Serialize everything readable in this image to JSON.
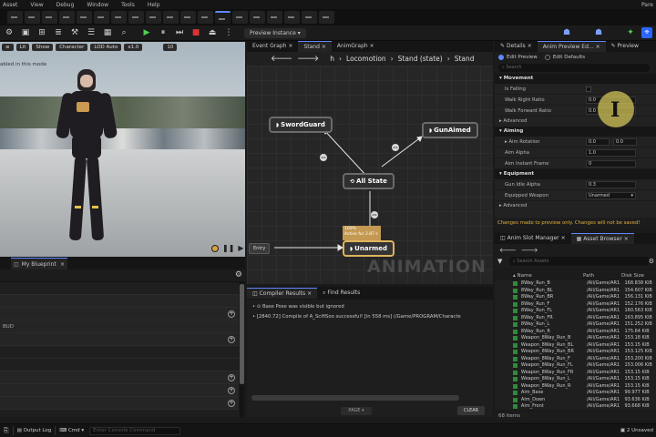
{
  "menubar": [
    "Asset",
    "View",
    "Debug",
    "Window",
    "Tools",
    "Help"
  ],
  "toolbar": {
    "preview_instance": "Preview Instance",
    "top_right_label": "Pare"
  },
  "viewport": {
    "buttons": [
      "Lit",
      "Show",
      "Character",
      "LOD Auto",
      "x1.0"
    ],
    "camera_speed": "10",
    "notice": "abled in this mode"
  },
  "blueprint_panel": {
    "tab_label": "My Blueprint",
    "row_label_a": "BUD"
  },
  "graph": {
    "tabs": [
      "Event Graph",
      "Stand",
      "AnimGraph"
    ],
    "breadcrumb": [
      "h",
      "Locomotion",
      "Stand (state)",
      "Stand"
    ],
    "nodes": {
      "sword_guard": "SwordGuard",
      "gun_aimed": "GunAimed",
      "all_state": "All State",
      "unarmed": "Unarmed"
    },
    "unarmed_tip_line1": "100%",
    "unarmed_tip_line2": "Active for 2.87 s",
    "entry": "Entry",
    "watermark": "ANIMATION"
  },
  "compiler": {
    "tabs": [
      "Compiler Results",
      "Find Results"
    ],
    "lines": [
      "Base Pose  was visible but ignored",
      "[2840.72] Compile of A_ScifiSoo successful! [in 558 ms] (/Game/PROGRAM/Characte"
    ],
    "page_label": "PAGE",
    "clear_label": "CLEAR"
  },
  "details": {
    "tabs": [
      "Details",
      "Anim Preview Ed...",
      "Preview"
    ],
    "edit_preview": "Edit Preview",
    "edit_defaults": "Edit Defaults",
    "search_placeholder": "Search",
    "movement_section": "Movement",
    "movement_props": [
      {
        "label": "Is Falling",
        "value": ""
      },
      {
        "label": "Walk Right Ratio",
        "value": "0.0"
      },
      {
        "label": "Walk Forward Ratio",
        "value": "0.0"
      }
    ],
    "advanced_label": "Advanced",
    "aiming_section": "Aiming",
    "aim_rotation": "Aim Rotation",
    "aim_rotation_values": [
      "0.0",
      "0.0"
    ],
    "aim_alpha": "Aim Alpha",
    "aim_alpha_value": "1.0",
    "aim_instant_frame": "Aim Instant Frame",
    "aim_instant_frame_value": "0",
    "equipment_section": "Equipment",
    "gun_idle_alpha": "Gun Idle Alpha",
    "gun_idle_alpha_value": "0.3",
    "equipped_weapon": "Equipped Weapon",
    "equipped_weapon_value": "Unarmed",
    "warning": "Changes made to preview only. Changes will not be saved!"
  },
  "asset_browser": {
    "tabs": [
      "Anim Slot Manager",
      "Asset Browser"
    ],
    "search_placeholder": "Search Assets",
    "columns": [
      "Name",
      "Path",
      "Disk Size"
    ],
    "rows": [
      {
        "name": "8Way_Run_B",
        "path": "/All/Game/AR1",
        "size": "168.838 KiB"
      },
      {
        "name": "8Way_Run_BL",
        "path": "/All/Game/AR1",
        "size": "154.607 KiB"
      },
      {
        "name": "8Way_Run_BR",
        "path": "/All/Game/AR1",
        "size": "156.131 KiB"
      },
      {
        "name": "8Way_Run_F",
        "path": "/All/Game/AR1",
        "size": "152.176 KiB"
      },
      {
        "name": "8Way_Run_FL",
        "path": "/All/Game/AR1",
        "size": "160.563 KiB"
      },
      {
        "name": "8Way_Run_FR",
        "path": "/All/Game/AR1",
        "size": "163.895 KiB"
      },
      {
        "name": "8Way_Run_L",
        "path": "/All/Game/AR1",
        "size": "151.252 KiB"
      },
      {
        "name": "8Way_Run_R",
        "path": "/All/Game/AR1",
        "size": "175.64 KiB"
      },
      {
        "name": "Weapon_8Way_Run_B",
        "path": "/All/Game/AR1",
        "size": "153.18 KiB"
      },
      {
        "name": "Weapon_8Way_Run_BL",
        "path": "/All/Game/AR1",
        "size": "153.15 KiB"
      },
      {
        "name": "Weapon_8Way_Run_BR",
        "path": "/All/Game/AR1",
        "size": "153.125 KiB"
      },
      {
        "name": "Weapon_8Way_Run_F",
        "path": "/All/Game/AR1",
        "size": "153.200 KiB"
      },
      {
        "name": "Weapon_8Way_Run_FL",
        "path": "/All/Game/AR1",
        "size": "153.006 KiB"
      },
      {
        "name": "Weapon_8Way_Run_FR",
        "path": "/All/Game/AR1",
        "size": "153.15 KiB"
      },
      {
        "name": "Weapon_8Way_Run_L",
        "path": "/All/Game/AR1",
        "size": "153.15 KiB"
      },
      {
        "name": "Weapon_8Way_Run_R",
        "path": "/All/Game/AR1",
        "size": "153.15 KiB"
      },
      {
        "name": "Aim_Base",
        "path": "/All/Game/AR1",
        "size": "99.977 KiB"
      },
      {
        "name": "Aim_Down",
        "path": "/All/Game/AR1",
        "size": "93.636 KiB"
      },
      {
        "name": "Aim_Front",
        "path": "/All/Game/AR1",
        "size": "93.668 KiB"
      }
    ],
    "count": "68 items"
  },
  "statusbar": {
    "content_drawer": "",
    "output_log": "Output Log",
    "cmd": "Cmd",
    "console_placeholder": "Enter Console Command",
    "unsaved": "2 Unsaved"
  },
  "colors": {
    "accent": "#5e88ff",
    "warning": "#e7b33d",
    "unarmed_border": "#e0b35c",
    "asset_icon": "#2f8a3a"
  }
}
